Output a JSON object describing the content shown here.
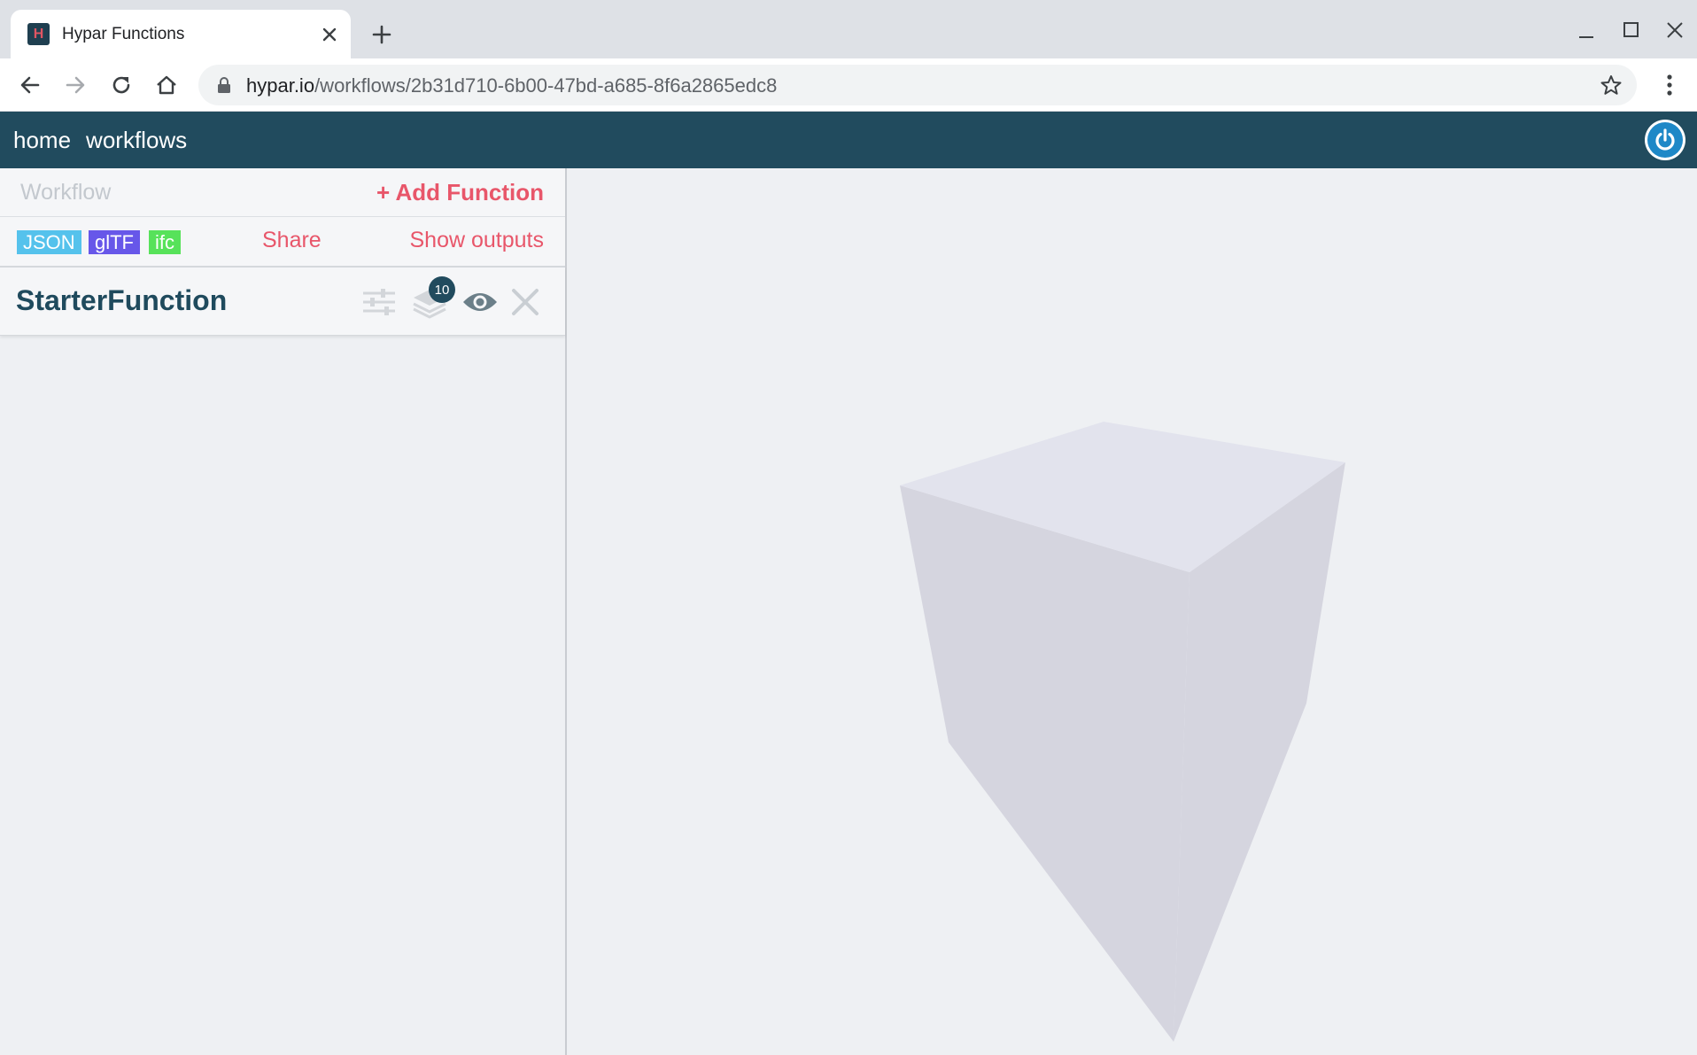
{
  "browser": {
    "tab_title": "Hypar Functions",
    "tab_favicon_letter": "H",
    "url_host": "hypar.io",
    "url_path": "/workflows/2b31d710-6b00-47bd-a685-8f6a2865edc8"
  },
  "app": {
    "nav": [
      "home",
      "workflows"
    ],
    "accent_color": "#e8566a",
    "header_color": "#214b5e"
  },
  "panel": {
    "workflow_label": "Workflow",
    "add_function_label": "+ Add Function",
    "formats": [
      {
        "label": "JSON",
        "color": "#55c2ec"
      },
      {
        "label": "glTF",
        "color": "#6757e9"
      },
      {
        "label": "ifc",
        "color": "#57e25a"
      }
    ],
    "share_label": "Share",
    "show_outputs_label": "Show outputs"
  },
  "function": {
    "name": "StarterFunction",
    "output_count": "10",
    "icons": [
      "sliders-icon",
      "layers-icon",
      "eye-icon",
      "close-icon"
    ]
  },
  "viewport": {
    "model": "cube",
    "face_colors": {
      "top": "#e2e3ed",
      "left": "#d5d5df",
      "right": "#d5d5df"
    }
  }
}
